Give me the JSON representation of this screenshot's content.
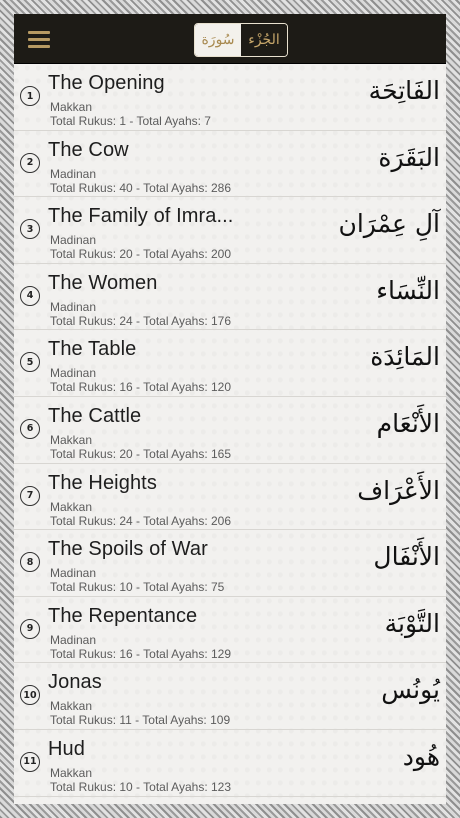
{
  "header": {
    "menu_icon": "hamburger-menu-icon",
    "segments": [
      {
        "label": "سُورَة",
        "selected": true
      },
      {
        "label": "الجُزْء",
        "selected": false
      }
    ]
  },
  "surahs": [
    {
      "number": "1",
      "name": "The Opening",
      "place": "Makkan",
      "totals": "Total Rukus: 1 - Total Ayahs: 7",
      "arabic": "الفَاتِحَة"
    },
    {
      "number": "2",
      "name": "The Cow",
      "place": "Madinan",
      "totals": "Total Rukus: 40 - Total Ayahs: 286",
      "arabic": "البَقَرَة"
    },
    {
      "number": "3",
      "name": "The Family of Imra...",
      "place": "Madinan",
      "totals": "Total Rukus: 20 - Total Ayahs: 200",
      "arabic": "آلِ عِمْرَان"
    },
    {
      "number": "4",
      "name": "The Women",
      "place": "Madinan",
      "totals": "Total Rukus: 24 - Total Ayahs: 176",
      "arabic": "النِّسَاء"
    },
    {
      "number": "5",
      "name": "The Table",
      "place": "Madinan",
      "totals": "Total Rukus: 16 - Total Ayahs: 120",
      "arabic": "المَائِدَة"
    },
    {
      "number": "6",
      "name": "The Cattle",
      "place": "Makkan",
      "totals": "Total Rukus: 20 - Total Ayahs: 165",
      "arabic": "الأَنْعَام"
    },
    {
      "number": "7",
      "name": "The Heights",
      "place": "Makkan",
      "totals": "Total Rukus: 24 - Total Ayahs: 206",
      "arabic": "الأَعْرَاف"
    },
    {
      "number": "8",
      "name": "The Spoils of War",
      "place": "Madinan",
      "totals": "Total Rukus: 10 - Total Ayahs: 75",
      "arabic": "الأَنْفَال"
    },
    {
      "number": "9",
      "name": "The Repentance",
      "place": "Madinan",
      "totals": "Total Rukus: 16 - Total Ayahs: 129",
      "arabic": "التَّوْبَة"
    },
    {
      "number": "10",
      "name": "Jonas",
      "place": "Makkan",
      "totals": "Total Rukus: 11 - Total Ayahs: 109",
      "arabic": "يُونُس"
    },
    {
      "number": "11",
      "name": "Hud",
      "place": "Makkan",
      "totals": "Total Rukus: 10 - Total Ayahs: 123",
      "arabic": "هُود"
    }
  ]
}
